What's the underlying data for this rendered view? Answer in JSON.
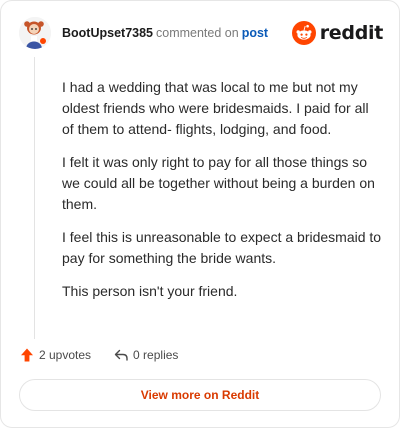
{
  "header": {
    "username": "BootUpset7385",
    "action_text": "commented on",
    "post_link": "post",
    "logo_text": "reddit"
  },
  "comment": {
    "paragraphs": [
      "I had a wedding that was local to me but not my oldest friends who were bridesmaids. I paid for all of them to attend- flights, lodging, and food.",
      "I felt it was only right to pay for all those things so we could all be together without being a burden on them.",
      "I feel this is unreasonable to expect a bridesmaid to pay for something the bride wants.",
      "This person isn't your friend."
    ]
  },
  "footer": {
    "upvotes": "2 upvotes",
    "replies": "0 replies",
    "upvote_icon": "upvote-arrow-icon",
    "reply_icon": "reply-arrow-icon"
  },
  "view_more": {
    "label": "View more on Reddit"
  },
  "colors": {
    "brand": "#ff4500",
    "link": "#0a5ab8",
    "cta": "#d93a00"
  }
}
